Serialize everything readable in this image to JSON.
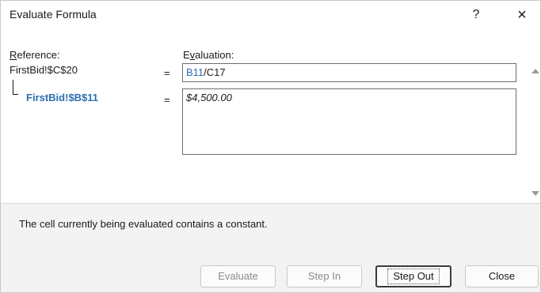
{
  "dialog": {
    "title": "Evaluate Formula",
    "help_label": "?",
    "close_label": "×"
  },
  "reference": {
    "label": "Reference:",
    "cell": "FirstBid!$C$20",
    "sub_cell": "FirstBid!$B$11"
  },
  "evaluation": {
    "label": "Evaluation:",
    "equals": "=",
    "formula_ref": "B11",
    "formula_rest": "/C17",
    "value": "$4,500.00"
  },
  "status_text": "The cell currently being evaluated contains a constant.",
  "buttons": {
    "evaluate": "Evaluate",
    "step_in": "Step In",
    "step_out": "Step Out",
    "close": "Close"
  },
  "colors": {
    "accent_blue": "#2a6fb0"
  }
}
